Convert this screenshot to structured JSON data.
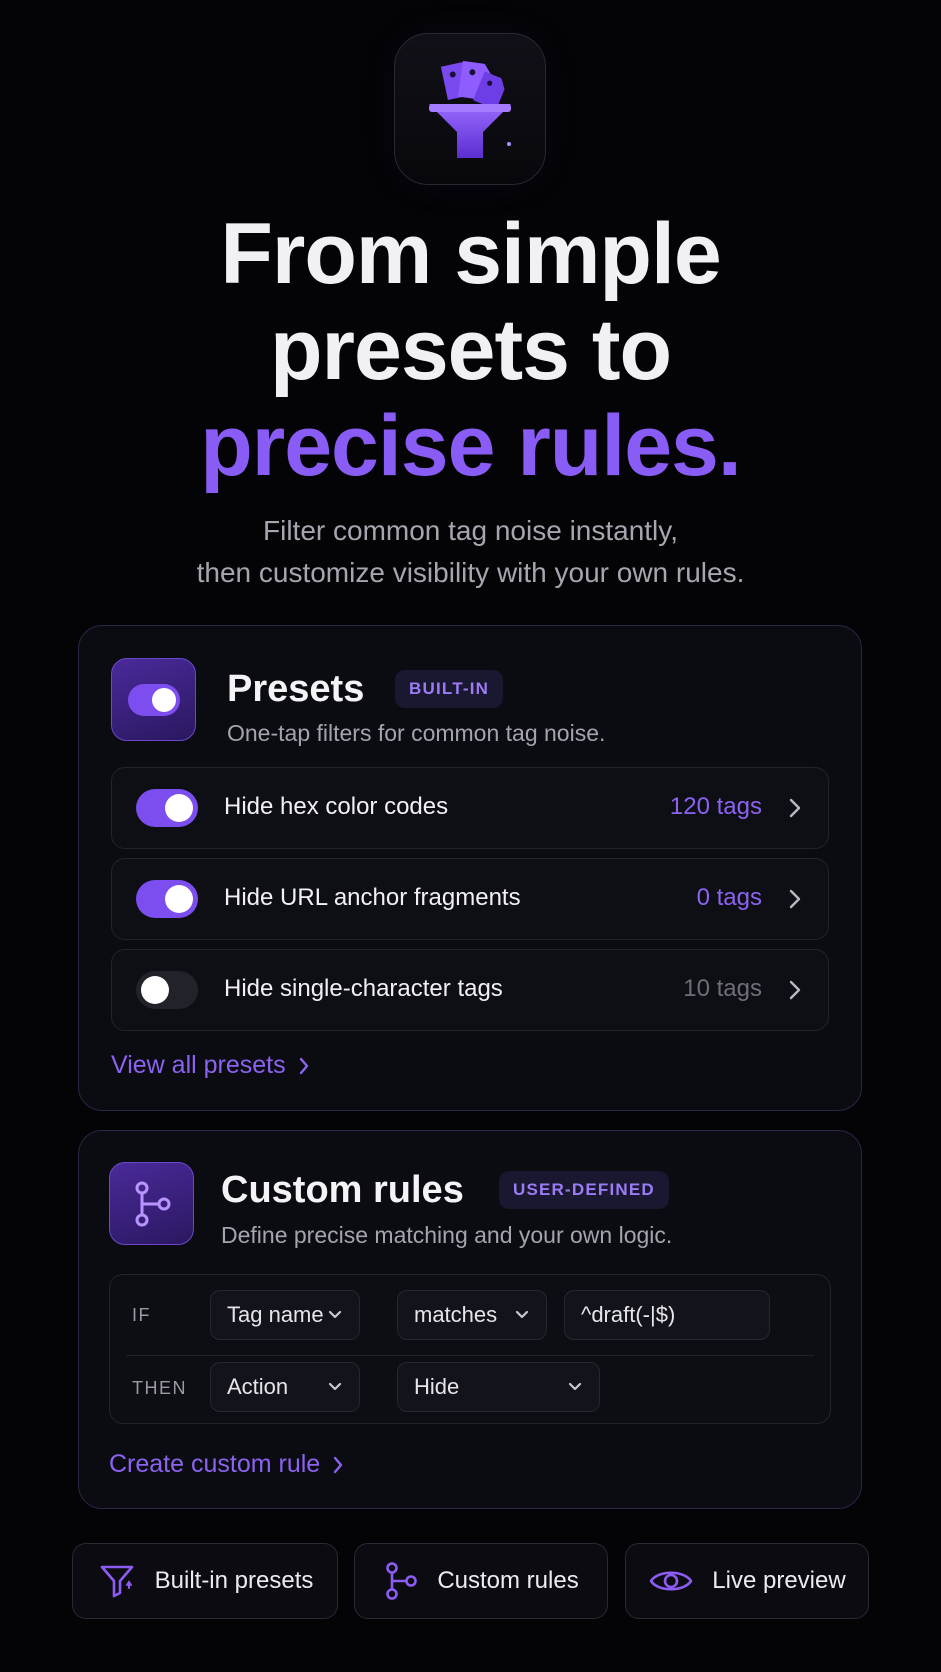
{
  "hero": {
    "app_icon": "tag-funnel-icon",
    "headline_line1": "From simple",
    "headline_line2": "presets to",
    "headline_accent": "precise rules.",
    "subhead_line1": "Filter common tag noise instantly,",
    "subhead_line2": "then customize visibility with your own rules."
  },
  "presets": {
    "icon": "toggle-icon",
    "title": "Presets",
    "badge": "BUILT-IN",
    "description": "One-tap filters for common tag noise.",
    "items": [
      {
        "label": "Hide hex color codes",
        "count": "120 tags",
        "enabled": true
      },
      {
        "label": "Hide URL anchor fragments",
        "count": "0 tags",
        "enabled": true
      },
      {
        "label": "Hide single-character tags",
        "count": "10 tags",
        "enabled": false
      }
    ],
    "view_all": "View all presets"
  },
  "custom_rules": {
    "icon": "branch-icon",
    "title": "Custom rules",
    "badge": "USER-DEFINED",
    "description": "Define precise matching and your own logic.",
    "if_label": "IF",
    "if_field": "Tag name",
    "if_operator": "matches",
    "if_value": "^draft(-|$)",
    "then_label": "THEN",
    "then_field": "Action",
    "then_value": "Hide",
    "create_link": "Create custom rule"
  },
  "features": [
    {
      "icon": "funnel-icon",
      "label": "Built-in presets"
    },
    {
      "icon": "branch-icon",
      "label": "Custom rules"
    },
    {
      "icon": "eye-icon",
      "label": "Live preview"
    }
  ],
  "colors": {
    "accent": "#8a5cf6",
    "background": "#040406",
    "card": "#0b0b12"
  }
}
